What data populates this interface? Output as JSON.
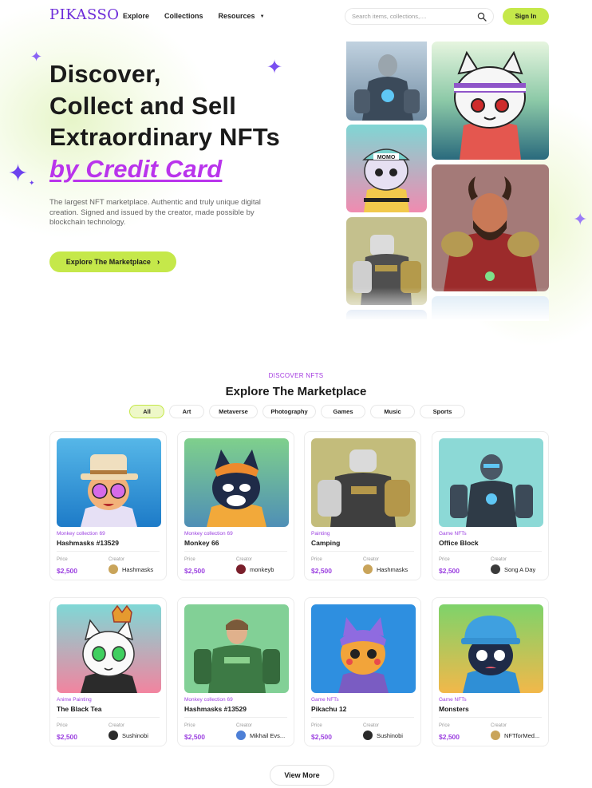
{
  "header": {
    "logo": "PIKASSO",
    "nav": [
      "Explore",
      "Collections",
      "Resources"
    ],
    "search_placeholder": "Search items, collections,....",
    "signin_label": "Sign In"
  },
  "hero": {
    "title_lines": [
      "Discover,",
      "Collect and Sell",
      "Extraordinary NFTs"
    ],
    "title_accent": "by Credit Card",
    "description": "The largest NFT marketplace. Authentic and truly unique digital creation. Signed and issued by the creator, made possible by blockchain technology.",
    "cta_label": "Explore The Marketplace"
  },
  "marketplace": {
    "kicker": "DISCOVER NFTS",
    "title": "Explore The Marketplace",
    "filters": [
      "All",
      "Art",
      "Metaverse",
      "Photography",
      "Games",
      "Music",
      "Sports"
    ],
    "active_filter": "All",
    "price_label": "Price",
    "creator_label": "Creator",
    "cards": [
      {
        "collection": "Monkey collection 69",
        "title": "Hashmasks #13529",
        "price": "$2,500",
        "creator": "Hashmasks"
      },
      {
        "collection": "Monkey collection 69",
        "title": "Monkey 66",
        "price": "$2,500",
        "creator": "monkeyb"
      },
      {
        "collection": "Painting",
        "title": "Camping",
        "price": "$2,500",
        "creator": "Hashmasks"
      },
      {
        "collection": "Game NFTs",
        "title": "Office Block",
        "price": "$2,500",
        "creator": "Song A Day"
      },
      {
        "collection": "Anime Painting",
        "title": "The Black Tea",
        "price": "$2,500",
        "creator": "Sushinobi"
      },
      {
        "collection": "Monkey collection 69",
        "title": "Hashmasks #13529",
        "price": "$2,500",
        "creator": "Mikhail Evs..."
      },
      {
        "collection": "Game NFTs",
        "title": "Pikachu 12",
        "price": "$2,500",
        "creator": "Sushinobi"
      },
      {
        "collection": "Game NFTs",
        "title": "Monsters",
        "price": "$2,500",
        "creator": "NFTforMed..."
      }
    ],
    "view_more_label": "View More"
  },
  "colors": {
    "brand_purple": "#6c2bd9",
    "accent_purple": "#b934ec",
    "lime": "#c5e84a"
  }
}
